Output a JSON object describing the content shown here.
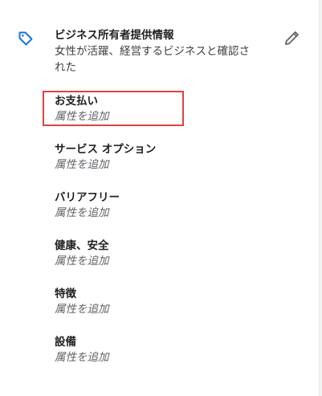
{
  "owner_section": {
    "title": "ビジネス所有者提供情報",
    "description": "女性が活躍、経営するビジネスと確認さ\nれた",
    "icon": "tag-icon",
    "edit_icon": "pencil-icon"
  },
  "attributes": [
    {
      "title": "お支払い",
      "subtitle": "属性を追加"
    },
    {
      "title": "サービス オプション",
      "subtitle": "属性を追加"
    },
    {
      "title": "バリアフリー",
      "subtitle": "属性を追加"
    },
    {
      "title": "健康、安全",
      "subtitle": "属性を追加"
    },
    {
      "title": "特徴",
      "subtitle": "属性を追加"
    },
    {
      "title": "設備",
      "subtitle": "属性を追加"
    }
  ],
  "colors": {
    "accent": "#1a73e8",
    "highlight": "#e0423d"
  }
}
